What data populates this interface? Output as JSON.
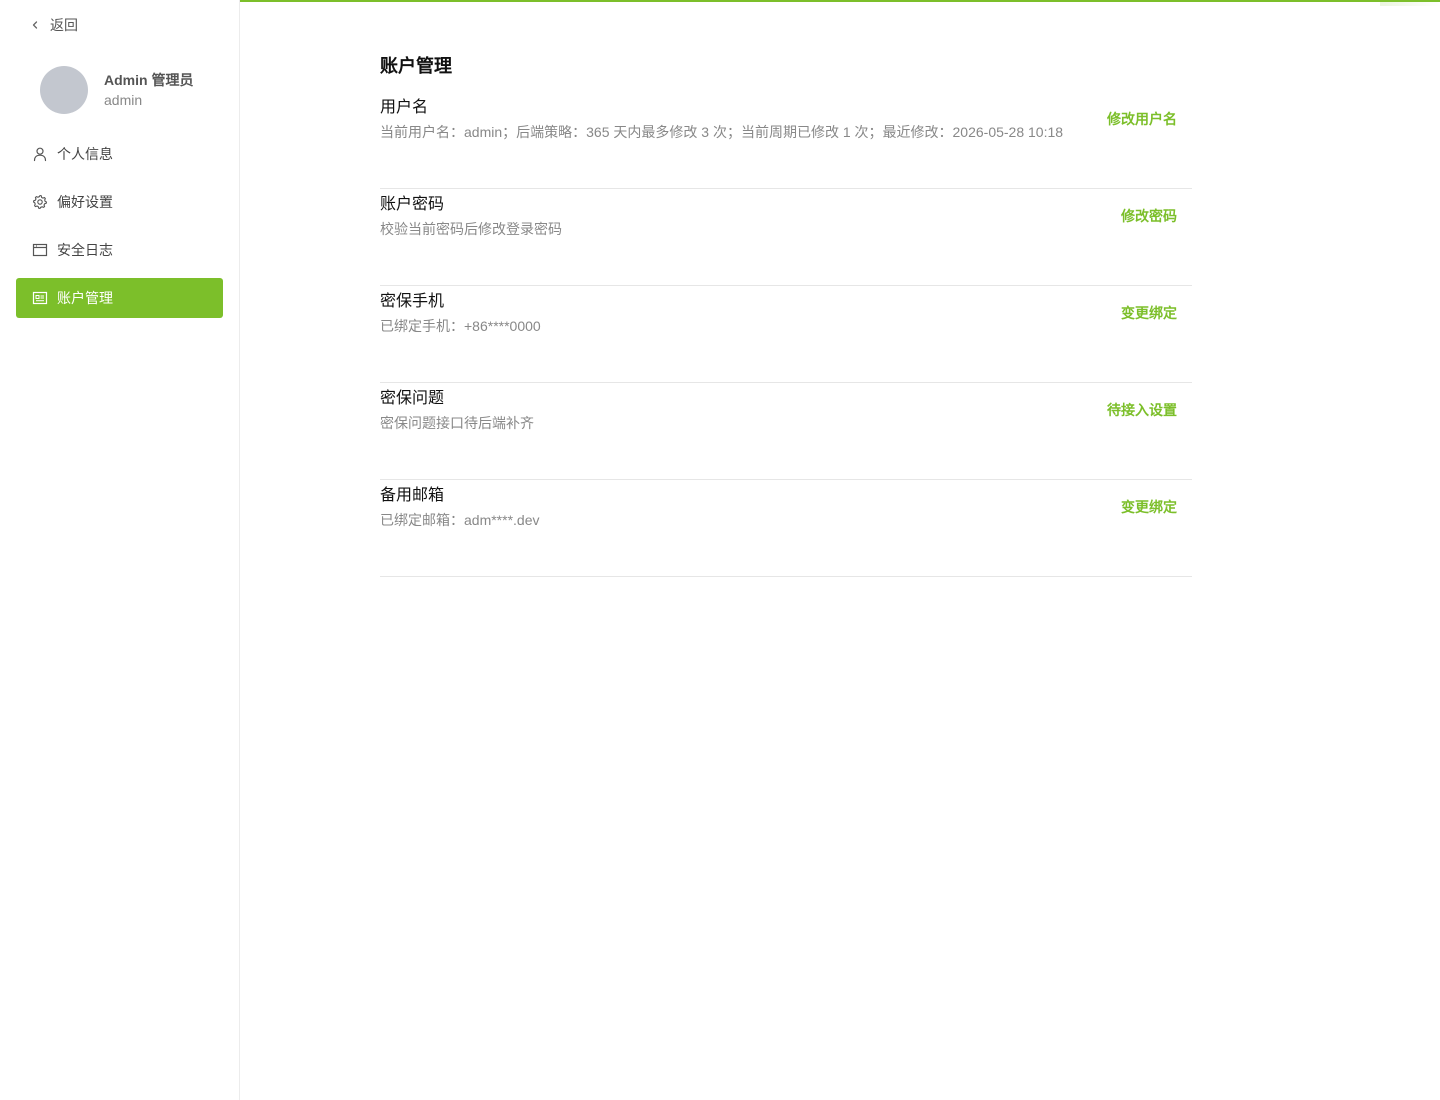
{
  "colors": {
    "accent": "#7cbf2a",
    "avatar": "#c3c7cf",
    "text_primary": "#111111",
    "text_secondary": "#888888",
    "divider": "#e6e6e6"
  },
  "sidebar": {
    "back_label": "返回",
    "profile": {
      "name": "Admin 管理员",
      "username": "admin"
    },
    "items": [
      {
        "label": "个人信息",
        "icon": "user-icon",
        "active": false
      },
      {
        "label": "偏好设置",
        "icon": "gear-icon",
        "active": false
      },
      {
        "label": "安全日志",
        "icon": "log-window-icon",
        "active": false
      },
      {
        "label": "账户管理",
        "icon": "id-card-icon",
        "active": true
      }
    ]
  },
  "main": {
    "title": "账户管理",
    "rows": [
      {
        "title": "用户名",
        "desc": "当前用户名：admin；后端策略：365 天内最多修改 3 次；当前周期已修改 1 次；最近修改：2026-05-28 10:18",
        "action": "修改用户名"
      },
      {
        "title": "账户密码",
        "desc": "校验当前密码后修改登录密码",
        "action": "修改密码"
      },
      {
        "title": "密保手机",
        "desc": "已绑定手机：+86****0000",
        "action": "变更绑定"
      },
      {
        "title": "密保问题",
        "desc": "密保问题接口待后端补齐",
        "action": "待接入设置"
      },
      {
        "title": "备用邮箱",
        "desc": "已绑定邮箱：adm****.dev",
        "action": "变更绑定"
      }
    ]
  }
}
